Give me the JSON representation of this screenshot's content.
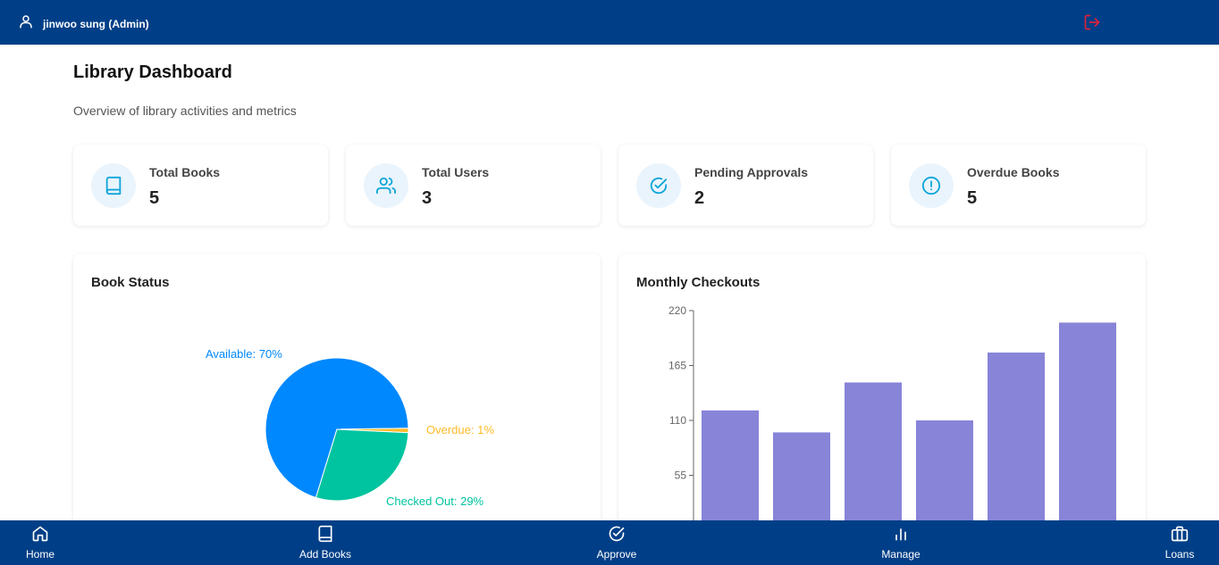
{
  "header": {
    "user_name": "jinwoo sung (Admin)",
    "user_icon": "user-icon",
    "logout_icon": "logout-icon",
    "logout_color": "#e0203b"
  },
  "page": {
    "title": "Library Dashboard",
    "subtitle": "Overview of library activities and metrics"
  },
  "stats": [
    {
      "label": "Total Books",
      "value": "5",
      "icon": "book-icon"
    },
    {
      "label": "Total Users",
      "value": "3",
      "icon": "users-icon"
    },
    {
      "label": "Pending Approvals",
      "value": "2",
      "icon": "check-circle-icon"
    },
    {
      "label": "Overdue Books",
      "value": "5",
      "icon": "alert-circle-icon"
    }
  ],
  "colors": {
    "nav_bg": "#003f87",
    "accent": "#0ea5d9",
    "available": "#0088fe",
    "checked_out": "#00c49f",
    "overdue": "#ffbb28",
    "bar": "#8884d8"
  },
  "chart_data": [
    {
      "type": "pie",
      "title": "Book Status",
      "slices": [
        {
          "label": "Available: 70%",
          "value": 70,
          "color": "#0088fe"
        },
        {
          "label": "Overdue: 1%",
          "value": 1,
          "color": "#ffbb28"
        },
        {
          "label": "Checked Out: 29%",
          "value": 29,
          "color": "#00c49f"
        }
      ]
    },
    {
      "type": "bar",
      "title": "Monthly Checkouts",
      "values": [
        120,
        98,
        148,
        110,
        178,
        208
      ],
      "yticks": [
        "220",
        "165",
        "110",
        "55"
      ],
      "ylim": [
        0,
        220
      ],
      "color": "#8884d8"
    }
  ],
  "nav": {
    "items": [
      {
        "label": "Home",
        "icon": "home-icon"
      },
      {
        "label": "Add Books",
        "icon": "book-icon"
      },
      {
        "label": "Approve",
        "icon": "check-circle-icon"
      },
      {
        "label": "Manage",
        "icon": "bar-chart-icon"
      },
      {
        "label": "Loans",
        "icon": "briefcase-icon"
      }
    ]
  }
}
